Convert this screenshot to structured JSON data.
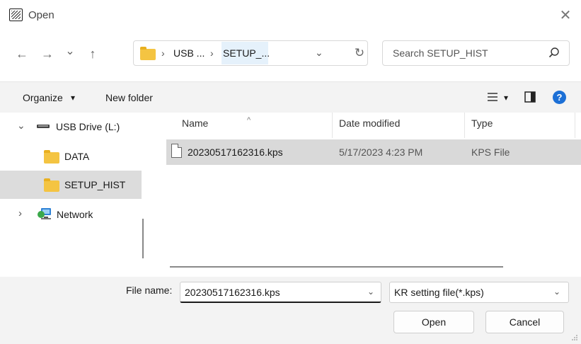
{
  "window": {
    "title": "Open",
    "close_symbol": "✕"
  },
  "nav": {
    "back": "←",
    "forward": "→",
    "recent": "⌄",
    "up": "↑",
    "refresh": "↻",
    "dropdown": "⌄"
  },
  "address": {
    "crumbs": [
      "USB ...",
      "SETUP_..."
    ],
    "separator": "›"
  },
  "search": {
    "placeholder": "Search SETUP_HIST"
  },
  "toolbar": {
    "organize": "Organize",
    "organize_arrow": "▾",
    "new_folder": "New folder",
    "view_arrow": "▾",
    "help": "?"
  },
  "tree": {
    "items": [
      {
        "label": "USB Drive (L:)",
        "expander": "⌄"
      },
      {
        "label": "DATA"
      },
      {
        "label": "SETUP_HIST",
        "selected": true
      },
      {
        "label": "Network",
        "expander": "›"
      }
    ]
  },
  "columns": {
    "name": "Name",
    "date": "Date modified",
    "type": "Type",
    "sort": "^"
  },
  "files": [
    {
      "name": "20230517162316.kps",
      "date": "5/17/2023 4:23 PM",
      "type": "KPS File"
    }
  ],
  "footer": {
    "file_name_label": "File name:",
    "file_name_value": "20230517162316.kps",
    "filter_value": "KR setting file(*.kps)",
    "open_label": "Open",
    "cancel_label": "Cancel"
  },
  "colors": {
    "accent": "#1b6fd6",
    "folder": "#f4c442",
    "selected_row": "#d9d9d9",
    "toolbar_bg": "#f3f3f3"
  }
}
